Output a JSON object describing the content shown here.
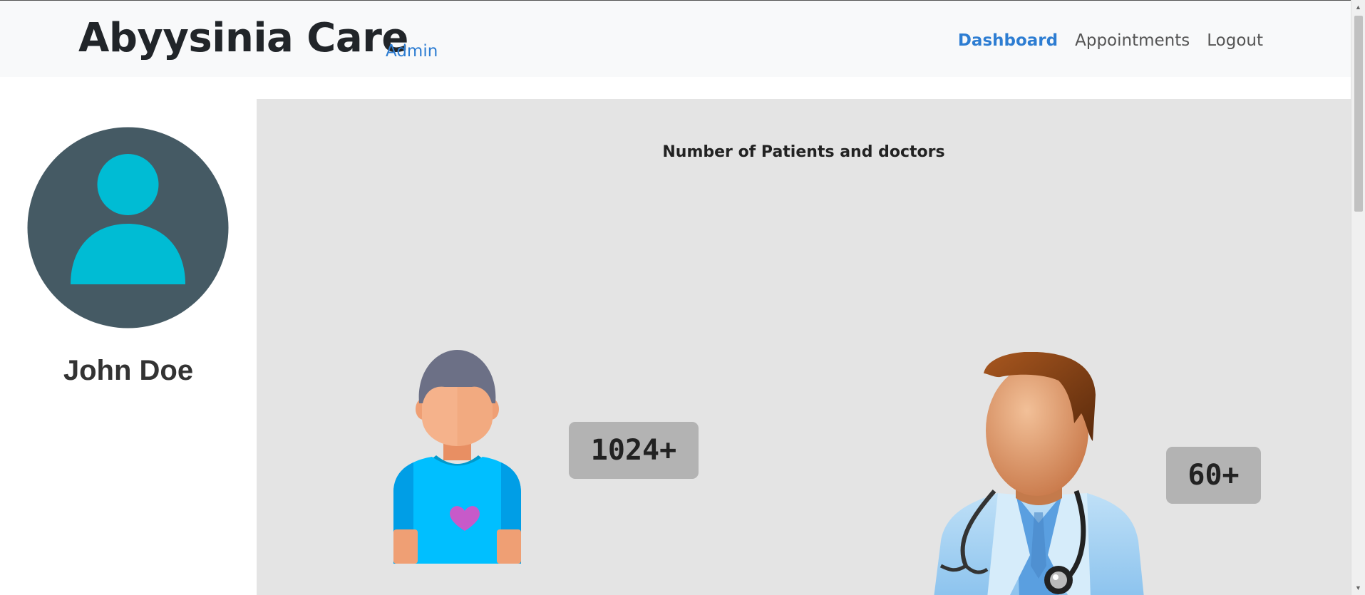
{
  "navbar": {
    "brand": "Abyysinia Care",
    "role_label": "Admin",
    "links": [
      {
        "label": "Dashboard",
        "active": true
      },
      {
        "label": "Appointments",
        "active": false
      },
      {
        "label": "Logout",
        "active": false
      }
    ],
    "accent_color": "#2d7dd2"
  },
  "sidebar": {
    "user_name": "John Doe",
    "avatar_icon": "user-avatar-icon"
  },
  "main": {
    "title": "Number of Patients and doctors",
    "stats": [
      {
        "icon": "patient-icon",
        "value": "1024+"
      },
      {
        "icon": "doctor-icon",
        "value": "60+"
      }
    ]
  }
}
